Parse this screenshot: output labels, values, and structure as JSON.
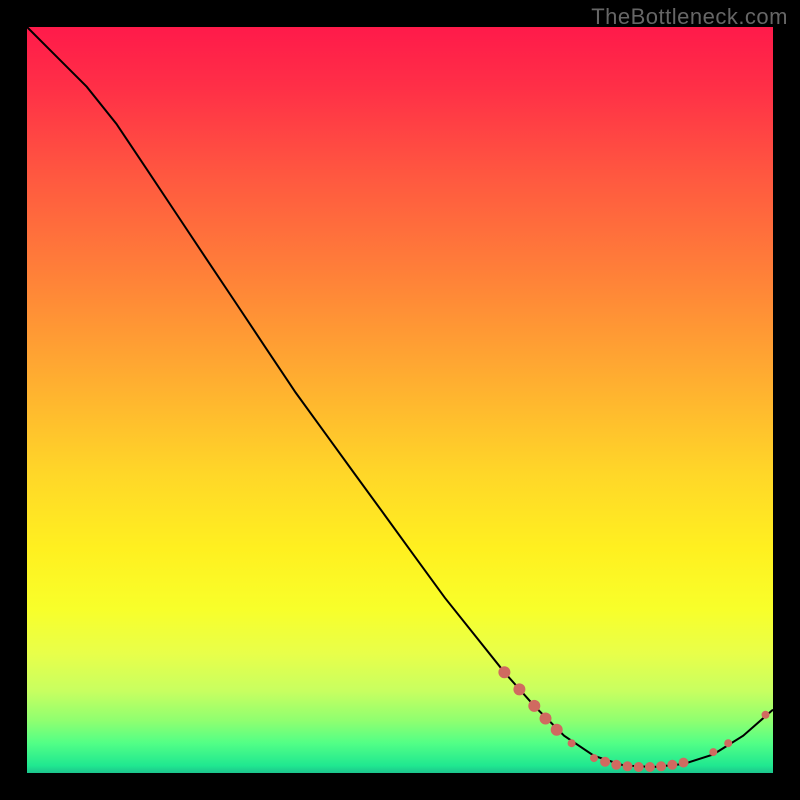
{
  "watermark": "TheBottleneck.com",
  "chart_data": {
    "type": "line",
    "title": "",
    "xlabel": "",
    "ylabel": "",
    "xlim": [
      0,
      100
    ],
    "ylim": [
      0,
      100
    ],
    "grid": false,
    "legend": false,
    "series": [
      {
        "name": "curve",
        "x": [
          0,
          4,
          8,
          12,
          16,
          20,
          24,
          28,
          32,
          36,
          40,
          44,
          48,
          52,
          56,
          60,
          64,
          68,
          72,
          76,
          80,
          84,
          88,
          92,
          96,
          100
        ],
        "y": [
          100,
          96,
          92,
          87,
          81,
          75,
          69,
          63,
          57,
          51,
          45.5,
          40,
          34.5,
          29,
          23.5,
          18.5,
          13.5,
          9,
          5,
          2.3,
          1.0,
          0.8,
          1.2,
          2.5,
          5.0,
          8.5
        ],
        "color": "#000000",
        "stroke_width": 2
      }
    ],
    "markers": [
      {
        "x": 64,
        "y": 13.5,
        "r": 6,
        "color": "#d06a60"
      },
      {
        "x": 66,
        "y": 11.2,
        "r": 6,
        "color": "#d06a60"
      },
      {
        "x": 68,
        "y": 9.0,
        "r": 6,
        "color": "#d06a60"
      },
      {
        "x": 69.5,
        "y": 7.3,
        "r": 6,
        "color": "#d06a60"
      },
      {
        "x": 71,
        "y": 5.8,
        "r": 6,
        "color": "#d06a60"
      },
      {
        "x": 73,
        "y": 4.0,
        "r": 4,
        "color": "#d06a60"
      },
      {
        "x": 76,
        "y": 2.0,
        "r": 4,
        "color": "#d06a60"
      },
      {
        "x": 77.5,
        "y": 1.5,
        "r": 5,
        "color": "#d06a60"
      },
      {
        "x": 79,
        "y": 1.1,
        "r": 5,
        "color": "#d06a60"
      },
      {
        "x": 80.5,
        "y": 0.9,
        "r": 5,
        "color": "#d06a60"
      },
      {
        "x": 82,
        "y": 0.8,
        "r": 5,
        "color": "#d06a60"
      },
      {
        "x": 83.5,
        "y": 0.8,
        "r": 5,
        "color": "#d06a60"
      },
      {
        "x": 85,
        "y": 0.9,
        "r": 5,
        "color": "#d06a60"
      },
      {
        "x": 86.5,
        "y": 1.1,
        "r": 5,
        "color": "#d06a60"
      },
      {
        "x": 88,
        "y": 1.4,
        "r": 5,
        "color": "#d06a60"
      },
      {
        "x": 92,
        "y": 2.8,
        "r": 4,
        "color": "#d06a60"
      },
      {
        "x": 94,
        "y": 4.0,
        "r": 4,
        "color": "#d06a60"
      },
      {
        "x": 99,
        "y": 7.8,
        "r": 4,
        "color": "#d06a60"
      }
    ]
  }
}
